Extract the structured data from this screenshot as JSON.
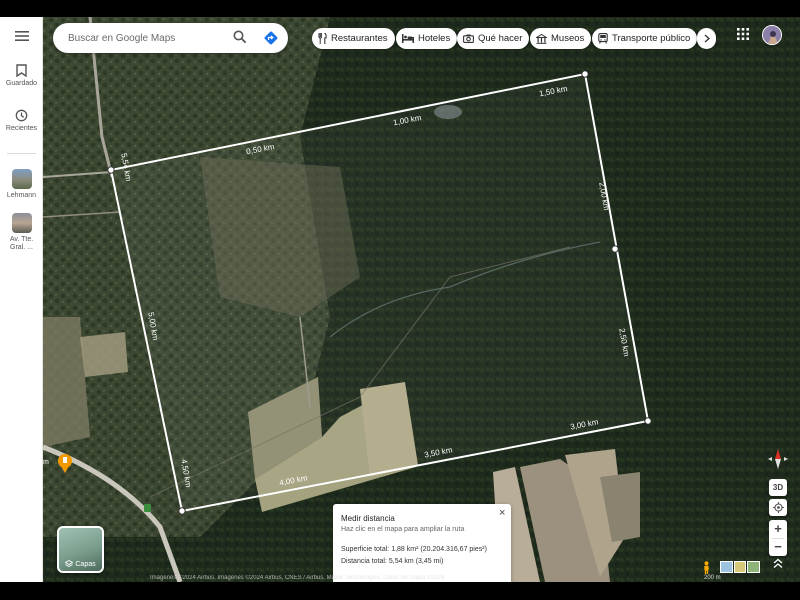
{
  "sidebar": {
    "menu_icon": "menu-icon",
    "items": [
      {
        "label": "Guardado",
        "icon": "bookmark-icon"
      },
      {
        "label": "Recientes",
        "icon": "history-icon"
      }
    ],
    "recent_places": [
      {
        "label": "Lehmann"
      },
      {
        "label": "Av. Tte. Gral. ..."
      }
    ]
  },
  "search": {
    "placeholder": "Buscar en Google Maps",
    "search_icon": "search-icon",
    "directions_icon": "directions-icon"
  },
  "chips": [
    {
      "label": "Restaurantes",
      "icon": "restaurant-icon"
    },
    {
      "label": "Hoteles",
      "icon": "hotel-icon"
    },
    {
      "label": "Qué hacer",
      "icon": "camera-icon"
    },
    {
      "label": "Museos",
      "icon": "museum-icon"
    },
    {
      "label": "Transporte público",
      "icon": "transit-icon"
    }
  ],
  "map": {
    "type": "satellite",
    "distance_labels": [
      "0,50 km",
      "1,00 km",
      "1,50 km",
      "2,00 km",
      "2,50 km",
      "3,00 km",
      "3,50 km",
      "4,00 km",
      "4,50 km",
      "5,00 km",
      "5,54 km"
    ]
  },
  "measure": {
    "title": "Medir distancia",
    "hint": "Haz clic en el mapa para ampliar la ruta",
    "area": "Superficie total: 1,88 km² (20.204.316,67 pies²)",
    "distance": "Distancia total: 5,54 km (3,45 mi)"
  },
  "layers": {
    "label": "Capas"
  },
  "controls": {
    "tilt_label": "3D"
  },
  "footer": {
    "attribution": "Imágenes ©2024 Airbus, Imágenes ©2024 Airbus, CNES / Airbus, Maxar Technologies, Datos del mapa ©2024",
    "scale": "200 m"
  },
  "colors": {
    "accent_blue": "#1a73e8",
    "measure_line": "#ffffff",
    "poi_orange": "#f29900"
  }
}
